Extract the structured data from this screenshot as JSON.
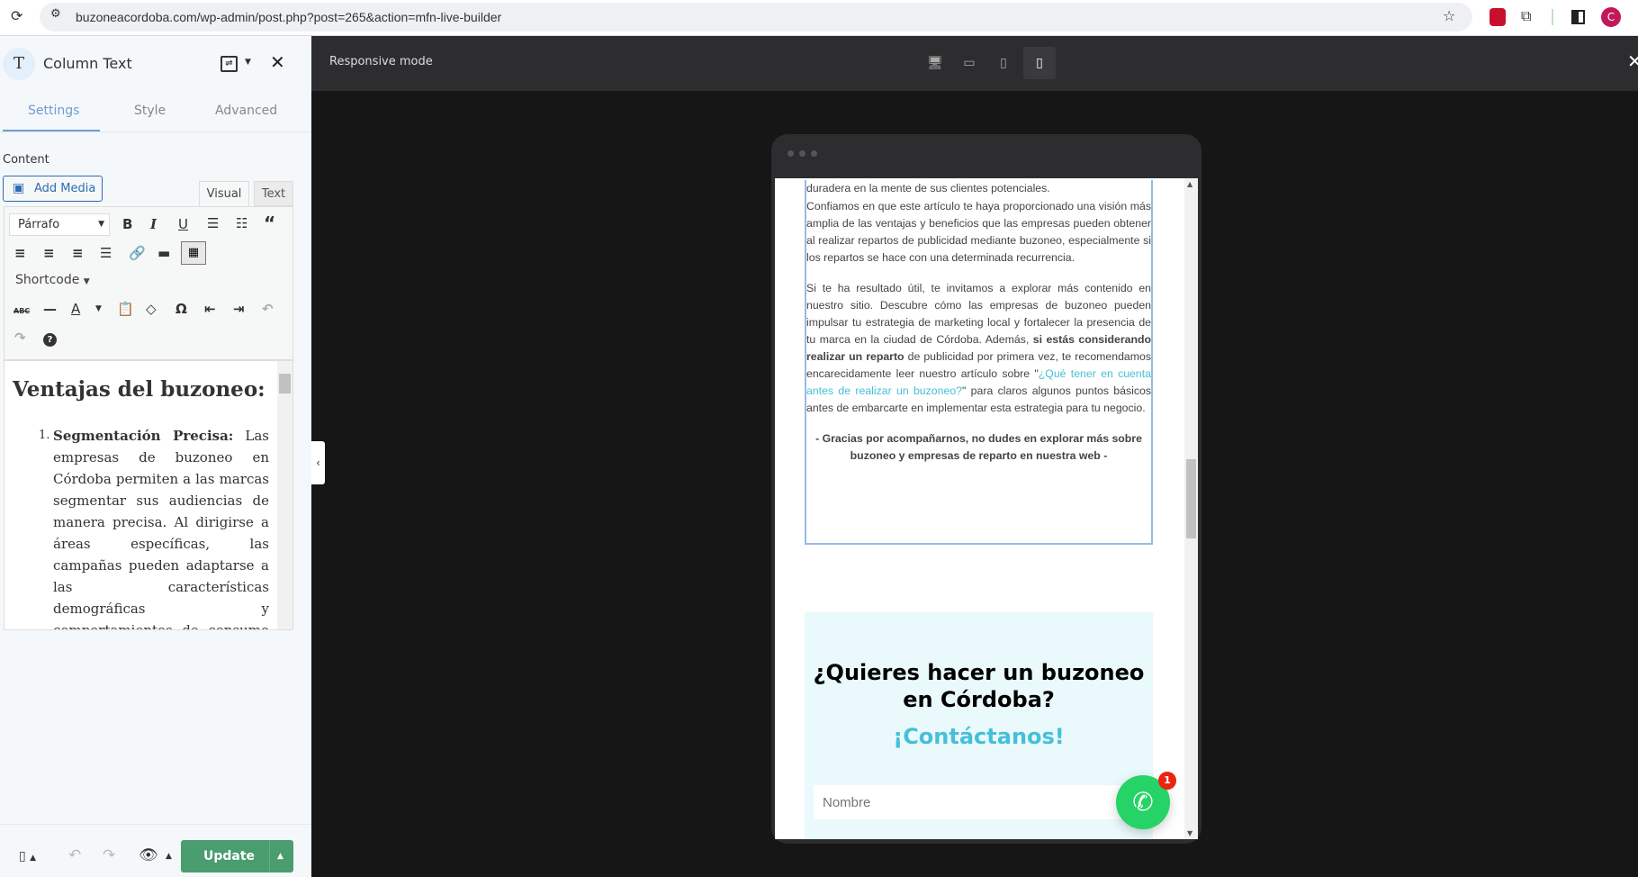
{
  "browser": {
    "url": "buzoneacordoba.com/wp-admin/post.php?post=265&action=mfn-live-builder",
    "profile_initial": "C"
  },
  "sidebar": {
    "title": "Column Text",
    "tabs": [
      "Settings",
      "Style",
      "Advanced"
    ],
    "active_tab": "Settings",
    "content_label": "Content",
    "add_media": "Add Media",
    "editor_tabs": [
      "Visual",
      "Text"
    ],
    "format_select": "Párrafo",
    "shortcode": "Shortcode",
    "editor": {
      "heading": "Ventajas del buzoneo:",
      "item_bold": "Segmentación Precisa:",
      "item_text": " Las empresas de buzoneo en Córdoba permiten a las marcas segmentar sus audiencias de manera precisa. Al dirigirse a áreas específicas, las campañas pueden adaptarse a las características demográficas y comportamientos de consumo locales, maximizando la relevancia de los mensajes."
    },
    "update_label": "Update"
  },
  "topbar": {
    "title": "Responsive mode",
    "active_device": "mobile"
  },
  "preview": {
    "cut_line": "duradera en la mente de sus clientes potenciales.",
    "p1": "Confiamos en que este artículo te haya proporcionado una visión más amplia de las ventajas y beneficios que las empresas pueden obtener al realizar repartos de publicidad mediante buzoneo, especialmente si los repartos se hace con una determinada recurrencia.",
    "p2a": "Si te ha resultado útil, te invitamos a explorar más contenido en nuestro sitio. Descubre cómo las empresas de buzoneo pueden impulsar tu estrategia de marketing local y fortalecer la presencia de tu marca en la ciudad de Córdoba. Además, ",
    "p2b": "si estás considerando realizar un reparto",
    "p2c": " de publicidad por primera vez, te recomendamos encarecidamente leer nuestro artículo sobre \"",
    "p2link": "¿Qué tener en cuenta antes de realizar un buzoneo?",
    "p2d": "\" para claros algunos puntos básicos antes de embarcarte en implementar esta estrategia para tu negocio.",
    "closing": "- Gracias por acompañarnos, no dudes en explorar más sobre buzoneo y empresas de reparto en nuestra web -",
    "cta_title": "¿Quieres hacer un buzoneo en Córdoba?",
    "cta_sub": "¡Contáctanos!",
    "name_placeholder": "Nombre",
    "whatsapp_badge": "1"
  },
  "colors": {
    "accent": "#45c0d8",
    "update": "#4a9d6e",
    "cta_bg": "#eaf9fb",
    "whatsapp": "#25d366"
  }
}
